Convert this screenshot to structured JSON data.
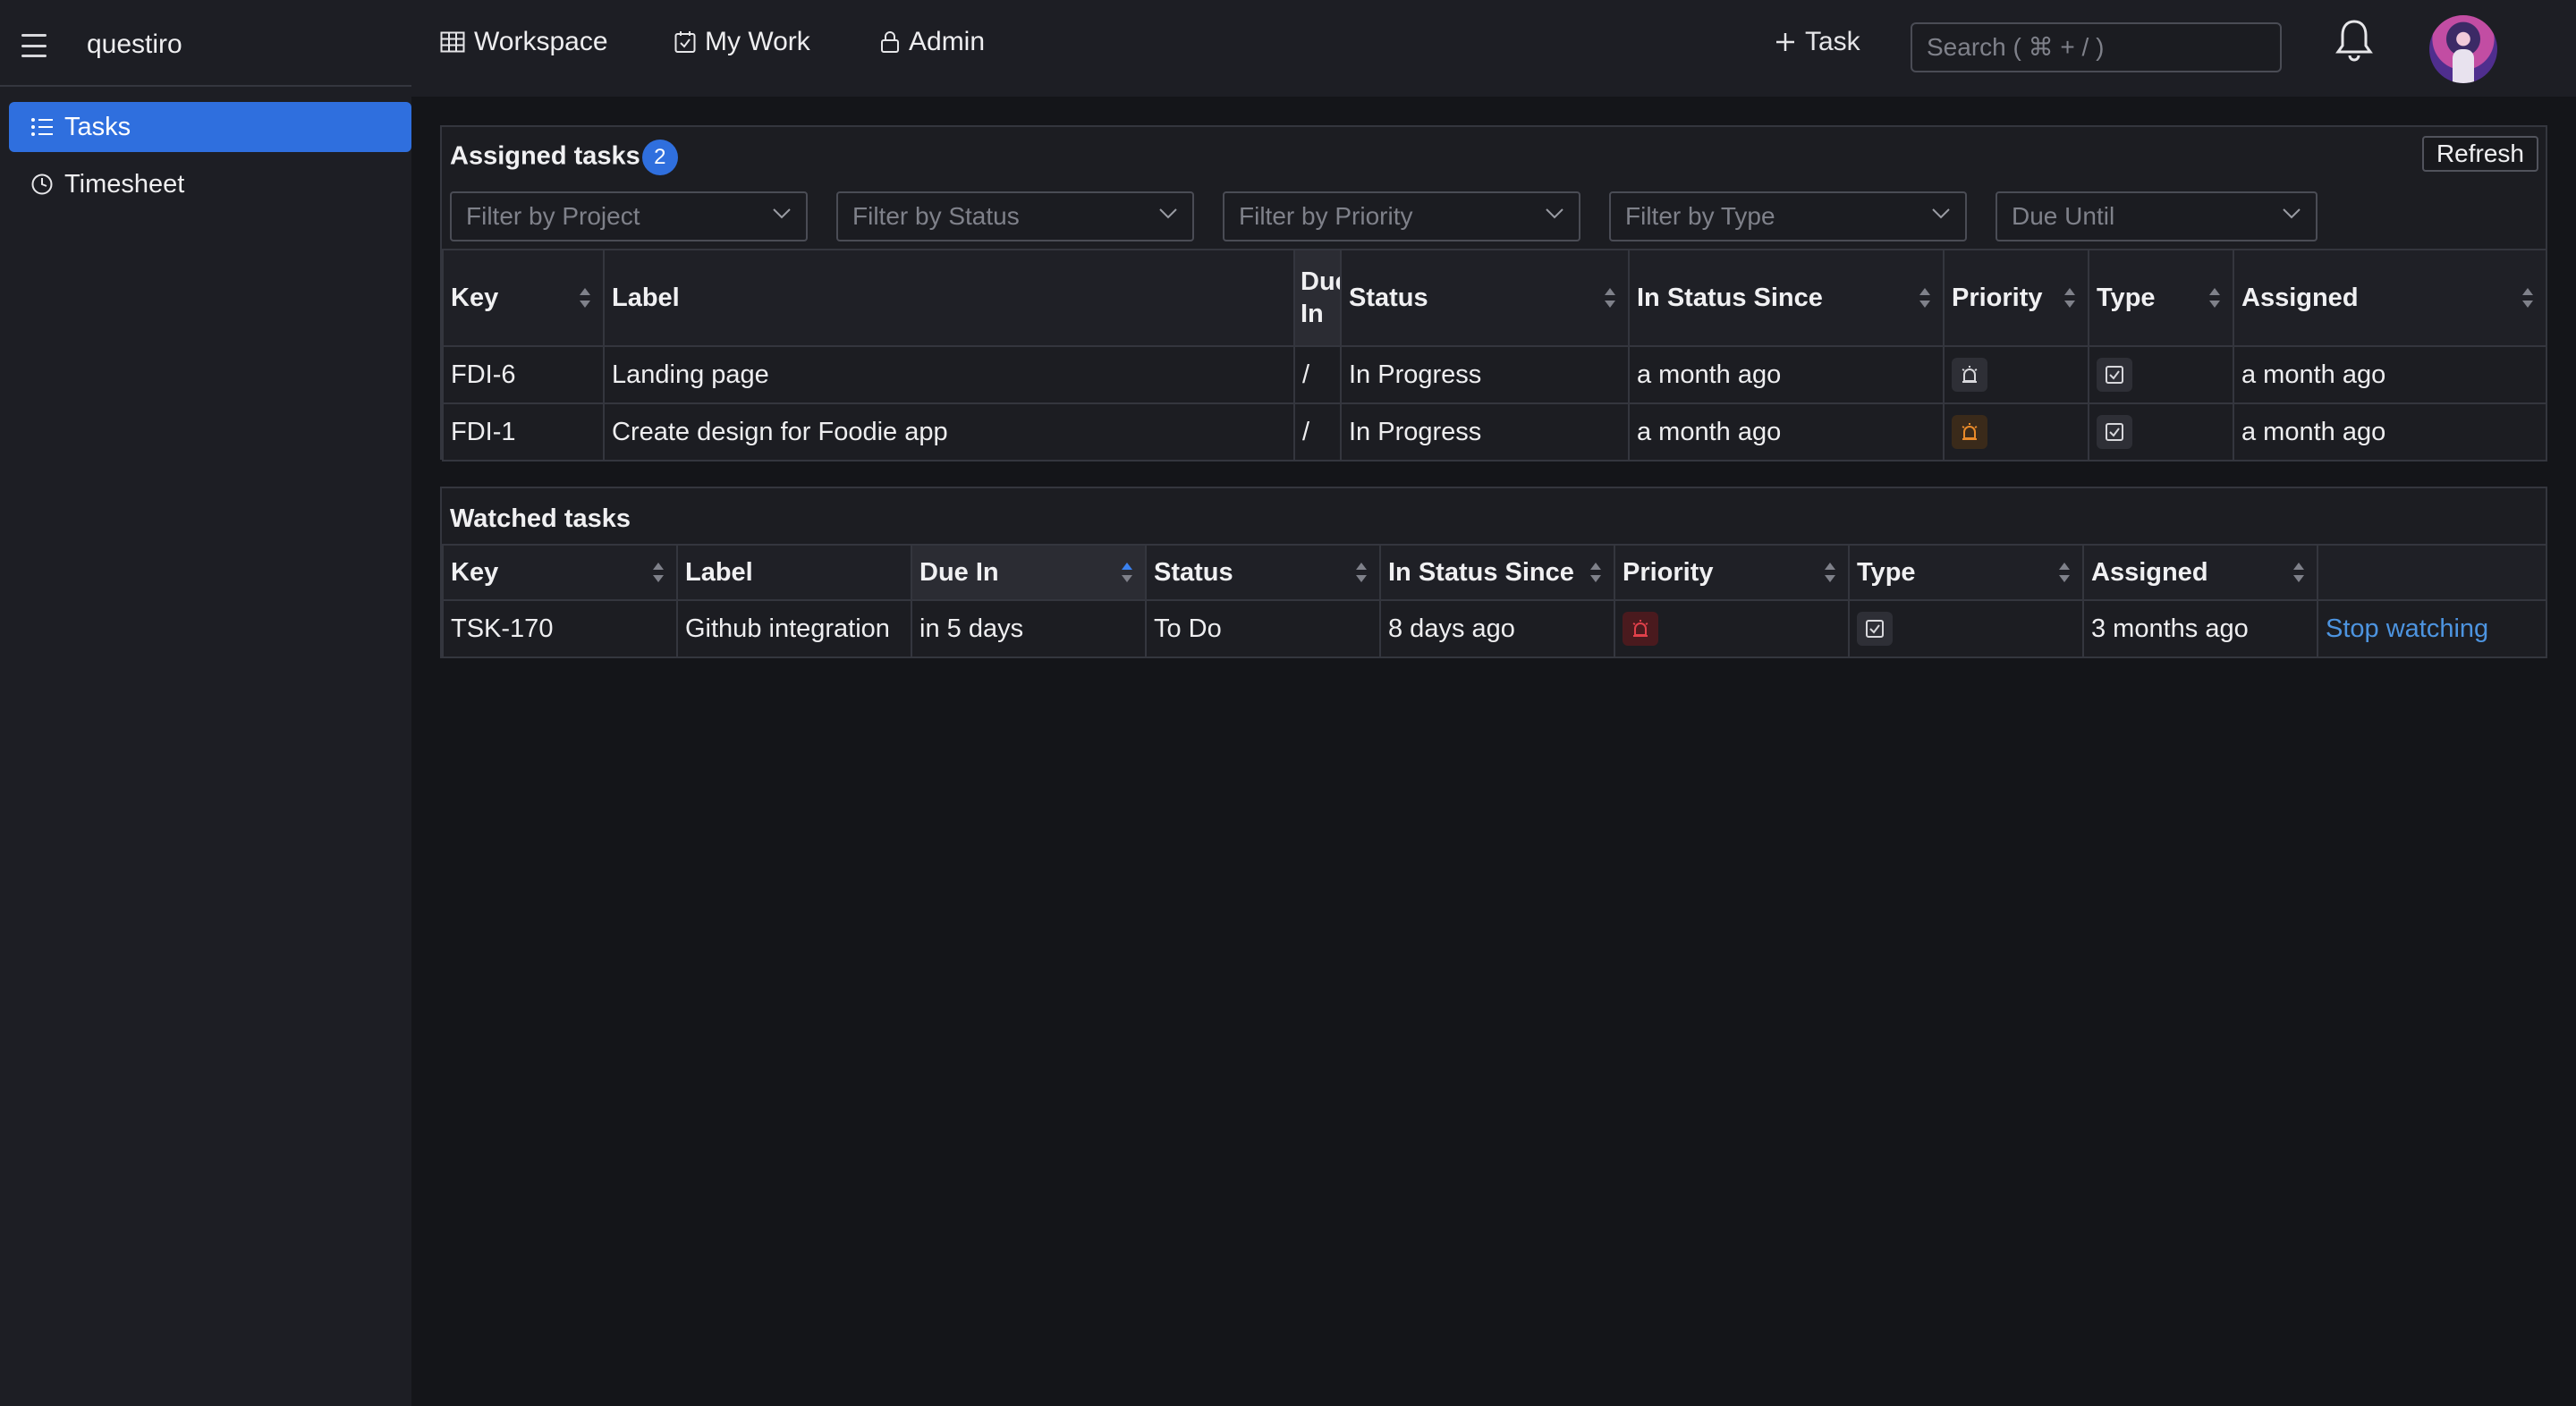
{
  "app": {
    "name": "questiro"
  },
  "nav": {
    "workspace": "Workspace",
    "my_work": "My Work",
    "admin": "Admin",
    "add_task": "Task",
    "search_placeholder": "Search ( ⌘ + / )"
  },
  "sidebar": {
    "items": [
      {
        "label": "Tasks",
        "icon": "list-icon",
        "active": true
      },
      {
        "label": "Timesheet",
        "icon": "clock-icon",
        "active": false
      }
    ]
  },
  "assigned": {
    "title": "Assigned tasks",
    "count": "2",
    "refresh_label": "Refresh",
    "filters": {
      "project": "Filter by Project",
      "status": "Filter by Status",
      "priority": "Filter by Priority",
      "type": "Filter by Type",
      "due": "Due Until"
    },
    "columns": {
      "key": "Key",
      "label": "Label",
      "due_line1": "Due",
      "due_line2": "In",
      "status": "Status",
      "since": "In Status Since",
      "priority": "Priority",
      "type": "Type",
      "assigned": "Assigned"
    },
    "rows": [
      {
        "key": "FDI-6",
        "label": "Landing page",
        "due": "/",
        "status": "In Progress",
        "since": "a month ago",
        "priority": "gray",
        "assigned": "a month ago"
      },
      {
        "key": "FDI-1",
        "label": "Create design for Foodie app",
        "due": "/",
        "status": "In Progress",
        "since": "a month ago",
        "priority": "orange",
        "assigned": "a month ago"
      }
    ]
  },
  "watched": {
    "title": "Watched tasks",
    "columns": {
      "key": "Key",
      "label": "Label",
      "due": "Due In",
      "status": "Status",
      "since": "In Status Since",
      "priority": "Priority",
      "type": "Type",
      "assigned": "Assigned"
    },
    "rows": [
      {
        "key": "TSK-170",
        "label": "Github integration",
        "due": "in 5 days",
        "status": "To Do",
        "since": "8 days ago",
        "priority": "red",
        "assigned": "3 months ago",
        "action": "Stop watching"
      }
    ]
  },
  "colors": {
    "accent": "#2f6fde",
    "link": "#4d94e0",
    "priority_medium": "#e88a2a",
    "priority_high": "#e0404a"
  }
}
